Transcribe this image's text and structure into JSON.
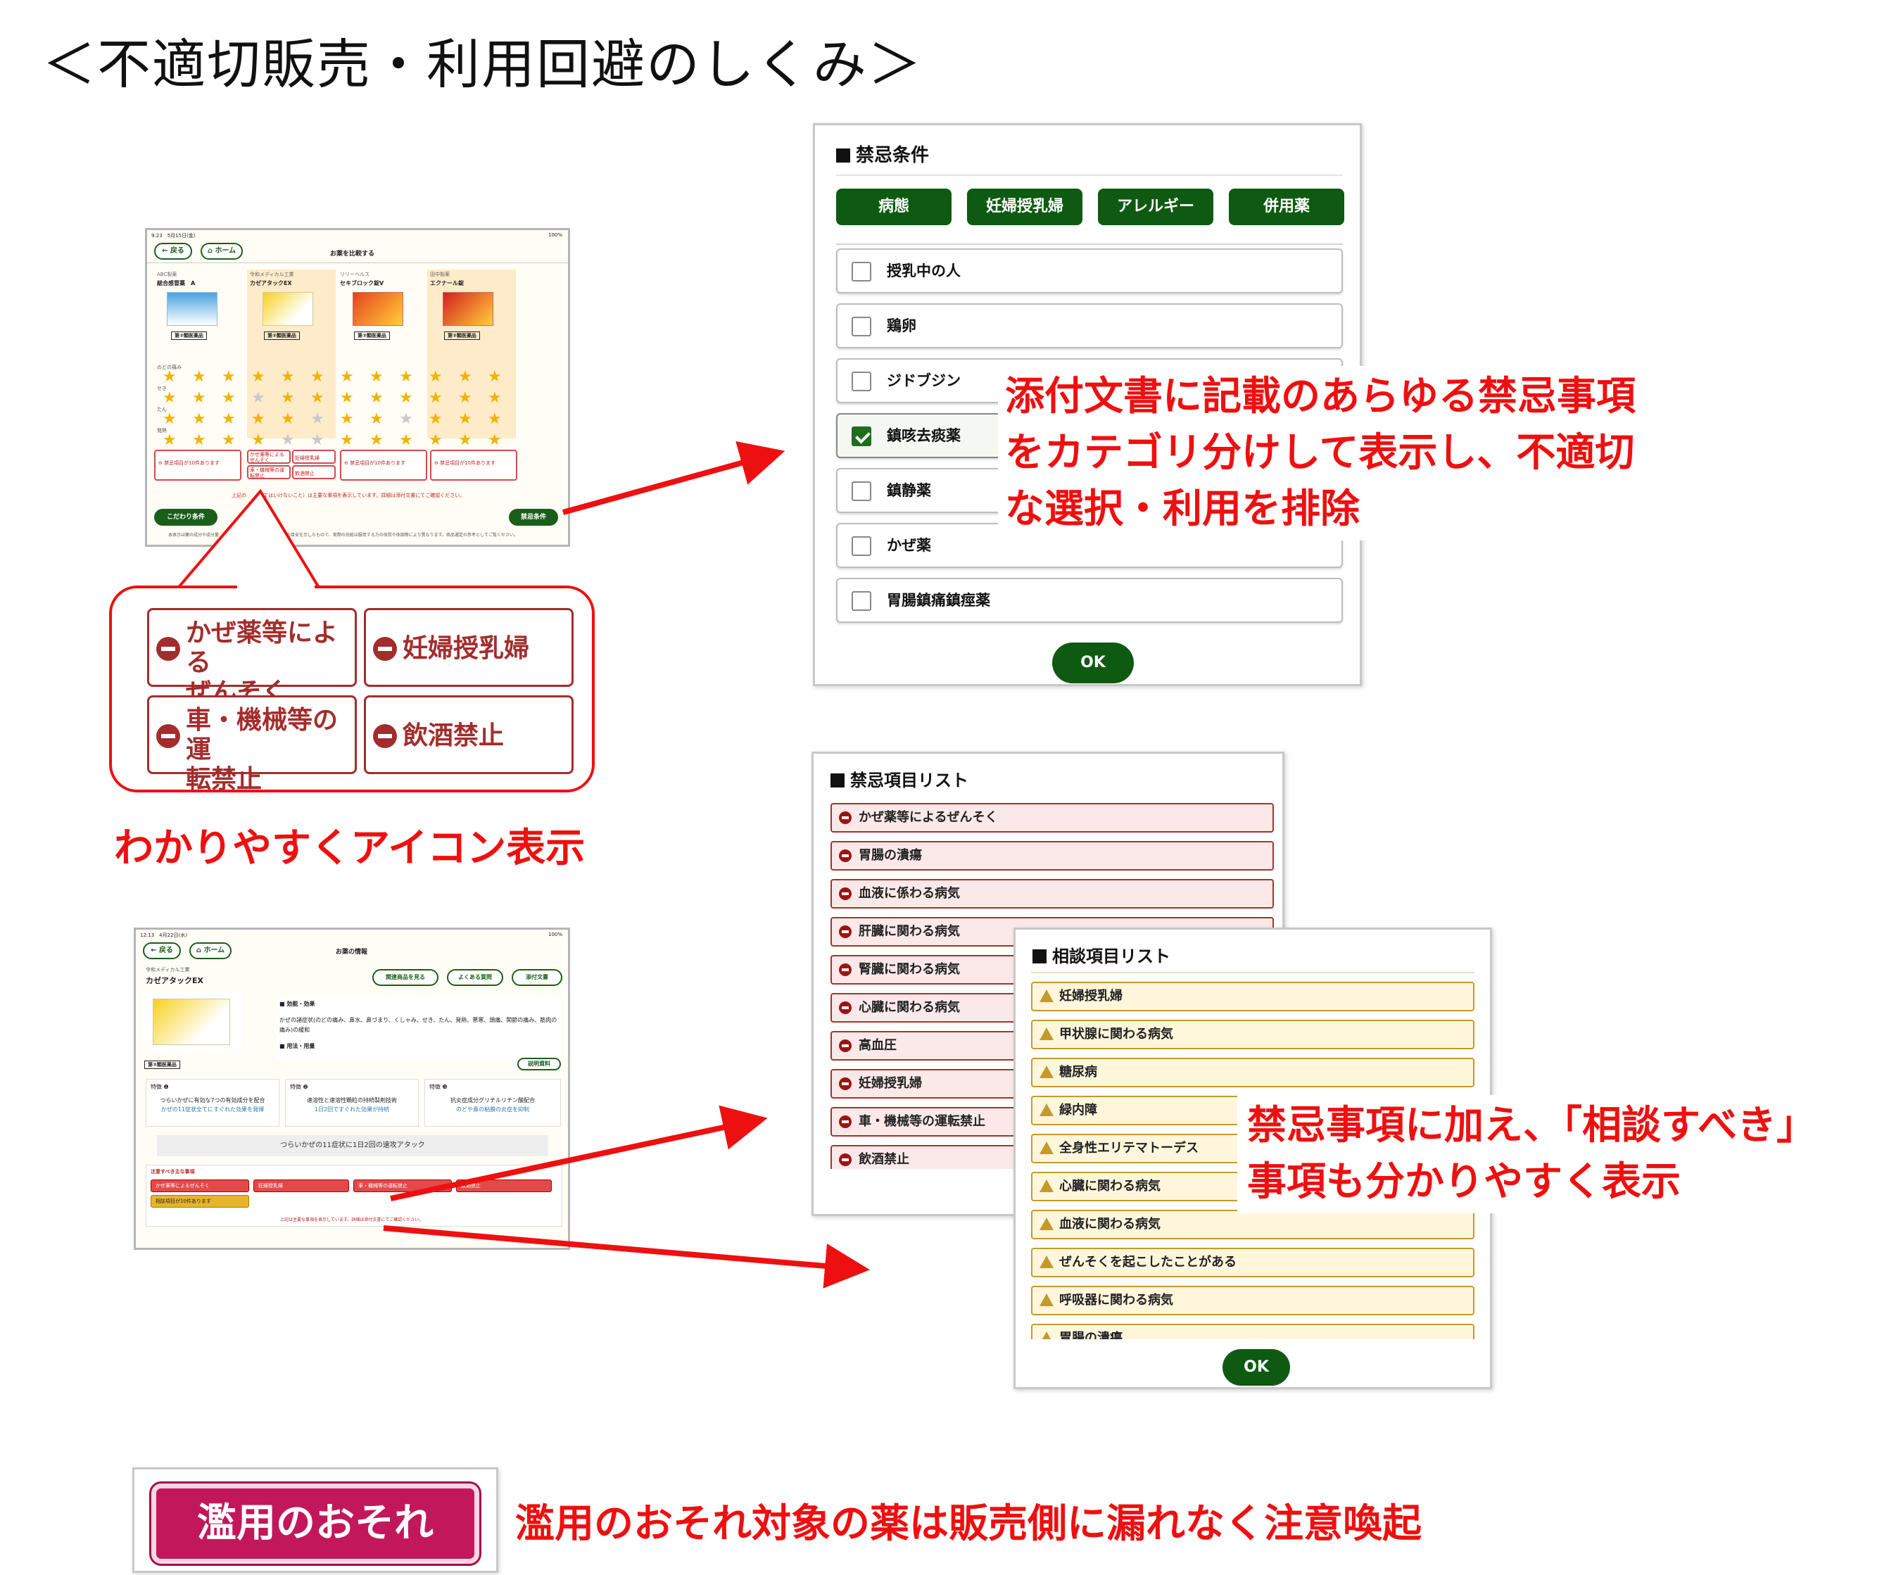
{
  "title": "＜不適切販売・利用回避のしくみ＞",
  "contra": {
    "header": "禁忌条件",
    "categories": [
      "病態",
      "妊婦授乳婦",
      "アレルギー",
      "併用薬"
    ],
    "items": [
      {
        "label": "授乳中の人",
        "checked": false
      },
      {
        "label": "鶏卵",
        "checked": false
      },
      {
        "label": "ジドブジン",
        "checked": false
      },
      {
        "label": "鎮咳去痰薬",
        "checked": true
      },
      {
        "label": "鎮静薬",
        "checked": false
      },
      {
        "label": "かぜ薬",
        "checked": false
      },
      {
        "label": "胃腸鎮痛鎮痙薬",
        "checked": false
      }
    ],
    "ok": "OK"
  },
  "annotations": {
    "a1": [
      "添付文書に記載のあらゆる禁忌事項",
      "をカテゴリ分けして表示し、不適切",
      "な選択・利用を排除"
    ],
    "a2": "わかりやすくアイコン表示",
    "a3": [
      "禁忌事項に加え、「相談すべき」",
      "事項も分かりやすく表示"
    ],
    "a4": "濫用のおそれ対象の薬は販売側に漏れなく注意喚起"
  },
  "callout": {
    "items": [
      [
        "かぜ薬等による",
        "ぜんそく"
      ],
      [
        "妊婦授乳婦"
      ],
      [
        "車・機械等の運",
        "転禁止"
      ],
      [
        "飲酒禁止"
      ]
    ]
  },
  "prohibited": {
    "header": "禁忌項目リスト",
    "items": [
      "かぜ薬等によるぜんそく",
      "胃腸の潰瘍",
      "血液に係わる病気",
      "肝臓に関わる病気",
      "腎臓に関わる病気",
      "心臓に関わる病気",
      "高血圧",
      "妊婦授乳婦",
      "車・機械等の運転禁止",
      "飲酒禁止"
    ]
  },
  "consult": {
    "header": "相談項目リスト",
    "items": [
      "妊婦授乳婦",
      "甲状腺に関わる病気",
      "糖尿病",
      "緑内障",
      "全身性エリテマトーデス",
      "心臓に関わる病気",
      "血液に関わる病気",
      "ぜんそくを起こしたことがある",
      "呼吸器に関わる病気",
      "胃腸の潰瘍"
    ],
    "ok": "OK"
  },
  "abuse_badge": "濫用のおそれ",
  "compare": {
    "status_time": "9:23　5月15日(金)",
    "battery": "100%",
    "back": "戻る",
    "home": "ホーム",
    "title": "お薬を比較する",
    "products": [
      {
        "maker": "ABC製薬",
        "name": "総合感冒薬　A"
      },
      {
        "maker": "令和メディカル工業",
        "name": "カゼアタックEX"
      },
      {
        "maker": "リリーヘルス",
        "name": "セキブロック錠V"
      },
      {
        "maker": "田中製薬",
        "name": "エクナール錠"
      }
    ],
    "drug_class": "第②類医薬品",
    "rows": [
      "のどの痛み",
      "せき",
      "たん",
      "発熱"
    ],
    "notes": [
      "禁忌項目が10件あります",
      "",
      "禁忌項目が10件あります",
      "禁忌項目が10件あります"
    ],
    "mini_icons": [
      "かぜ薬等によるぜんそく",
      "妊婦授乳婦",
      "車・機械等の運転禁止",
      "飲酒禁止"
    ],
    "footnote": "上記の　　（してはいけないこと）は主要な事項を表示しています。詳細は添付文書にてご確認ください。",
    "left_btn": "こだわり条件",
    "right_btn": "禁忌条件",
    "disclaimer": "本表示は薬の成分や成分量　　　　　　　　　　　　　　　のの目安を示したもので、実際の効能は服用する方の体質や体調等により異なります。商品選定の参考としてご覧ください。"
  },
  "detail": {
    "status_time": "12:13　4月22日(水)",
    "battery": "100%",
    "back": "戻る",
    "home": "ホーム",
    "title": "お薬の情報",
    "maker": "令和メディカル工業",
    "name": "カゼアタックEX",
    "buttons": [
      "関連商品を見る",
      "よくある質問",
      "添付文書"
    ],
    "effect_h": "■ 効能・効果",
    "effect": "かぜの諸症状(のどの痛み、鼻水、鼻づまり、くしゃみ、せき、たん、発熱、悪寒、頭痛、関節の痛み、筋肉の痛み)の緩和",
    "usage_h": "■ 用法・用量",
    "drug_class": "第②類医薬品",
    "explain_btn": "説明資料",
    "features": [
      {
        "h": "特徴 ❶",
        "t": "つらいかぜに有効な7つの有効成分を配合",
        "s": "かぜの11症状全てにすぐれた効果を発揮"
      },
      {
        "h": "特徴 ❷",
        "t": "速溶性と速溶性顆粒の持続製剤技術",
        "s": "1日2回ですぐれた効果が持続"
      },
      {
        "h": "特徴 ❸",
        "t": "抗炎症成分グリチルリチン酸配合",
        "s": "のどや鼻の粘膜の炎症を抑制"
      }
    ],
    "banner": "つらいかぜの11症状に1日2回の速攻アタック",
    "caution_h": "注意すべき主な事項",
    "cautions": [
      "かぜ薬等によるぜんそく",
      "妊婦授乳婦",
      "車・機械等の運転禁止",
      "飲酒禁止"
    ],
    "consult_bar": "相談項目が10件あります",
    "footnote": "上記は主要な事項を表示しています。詳細は添付文書にてご確認ください。"
  },
  "colors": {
    "green": "#0f5a12",
    "annotation_red": "#ee1010",
    "contra_red": "#a32d2d",
    "consult_yellow": "#c49a2a",
    "abuse_badge": "#c2185b"
  }
}
